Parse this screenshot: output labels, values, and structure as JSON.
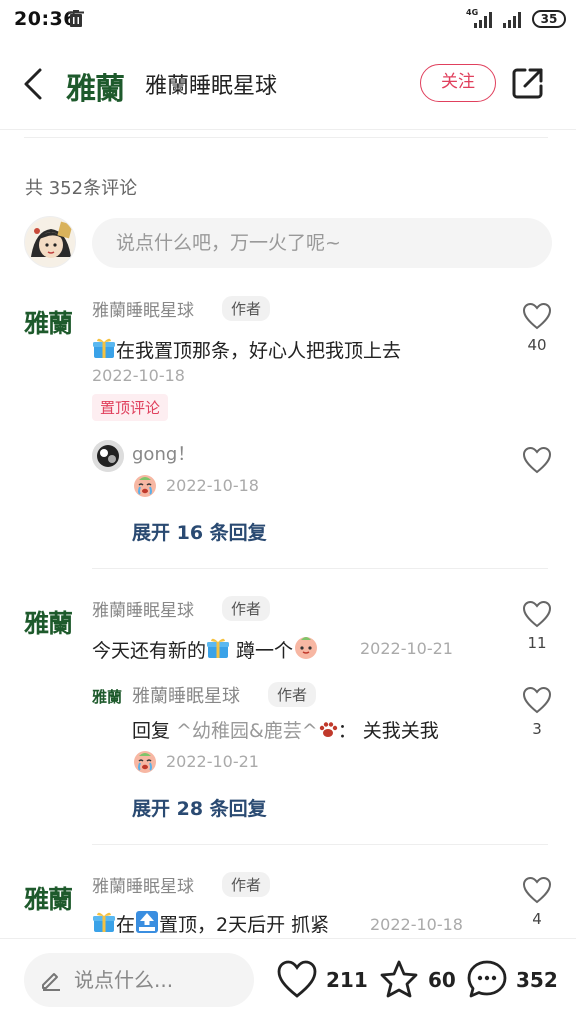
{
  "status_bar": {
    "time": "20:36",
    "network_label": "4G",
    "battery": "35"
  },
  "header": {
    "brand_logo": "雅蘭",
    "title": "雅蘭睡眠星球",
    "follow_label": "关注"
  },
  "comments_count": "共 352条评论",
  "comment_input_placeholder": "说点什么吧，万一火了呢~",
  "comments": [
    {
      "logo": "雅蘭",
      "name": "雅蘭睡眠星球",
      "badge": "作者",
      "text": "在我置顶那条，好心人把我顶上去",
      "date": "2022-10-18",
      "pin_label": "置顶评论",
      "likes": "40",
      "reply": {
        "name": "gong！",
        "date": "2022-10-18"
      },
      "expand": "展开 16 条回复"
    },
    {
      "logo": "雅蘭",
      "name": "雅蘭睡眠星球",
      "badge": "作者",
      "text_a": "今天还有新的",
      "text_b": " 蹲一个",
      "date": "2022-10-21",
      "likes": "11",
      "reply": {
        "logo": "雅蘭",
        "name": "雅蘭睡眠星球",
        "badge": "作者",
        "prefix": "回复",
        "target": " ^幼稚园&鹿芸^",
        "text": "： 关我关我",
        "date": "2022-10-21",
        "likes": "3"
      },
      "expand": "展开 28 条回复"
    },
    {
      "logo": "雅蘭",
      "name": "雅蘭睡眠星球",
      "badge": "作者",
      "text_a": "在",
      "text_b": "置顶，2天后开 抓紧",
      "date": "2022-10-18",
      "likes": "4"
    }
  ],
  "bottom_bar": {
    "input_placeholder": "说点什么...",
    "likes": "211",
    "stars": "60",
    "comments": "352"
  },
  "colors": {
    "accent": "#e0405d",
    "brand_green": "#1e5a2c",
    "link": "#2a4a72"
  }
}
